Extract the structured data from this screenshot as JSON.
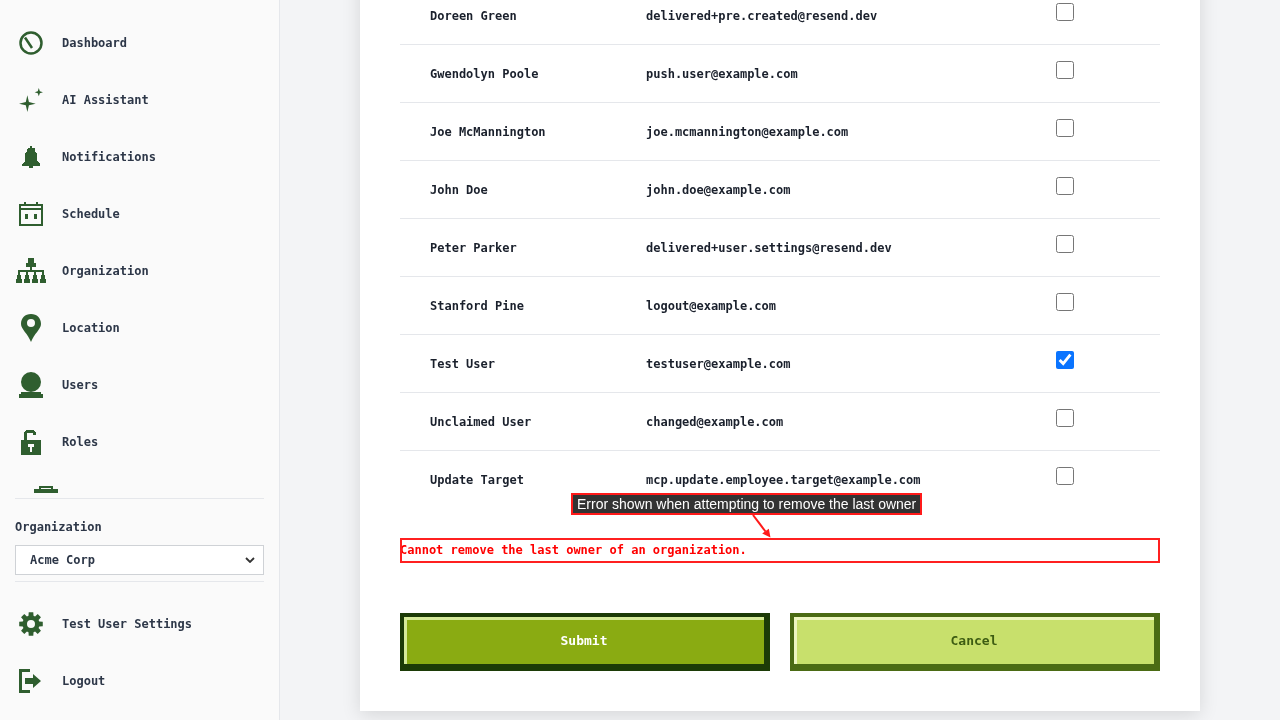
{
  "sidebar": {
    "nav_items": [
      {
        "label": "Dashboard"
      },
      {
        "label": "AI Assistant"
      },
      {
        "label": "Notifications"
      },
      {
        "label": "Schedule"
      },
      {
        "label": "Organization"
      },
      {
        "label": "Location"
      },
      {
        "label": "Users"
      },
      {
        "label": "Roles"
      }
    ],
    "organization_picker": {
      "label": "Organization",
      "value": "Acme Corp"
    },
    "footer_items": [
      {
        "label": "Test User Settings"
      },
      {
        "label": "Logout"
      }
    ]
  },
  "members_table": {
    "rows": [
      {
        "name": "Doreen Green",
        "email": "delivered+pre.created@resend.dev",
        "checked": false
      },
      {
        "name": "Gwendolyn Poole",
        "email": "push.user@example.com",
        "checked": false
      },
      {
        "name": "Joe McMannington",
        "email": "joe.mcmannington@example.com",
        "checked": false
      },
      {
        "name": "John Doe",
        "email": "john.doe@example.com",
        "checked": false
      },
      {
        "name": "Peter Parker",
        "email": "delivered+user.settings@resend.dev",
        "checked": false
      },
      {
        "name": "Stanford Pine",
        "email": "logout@example.com",
        "checked": false
      },
      {
        "name": "Test User",
        "email": "testuser@example.com",
        "checked": true
      },
      {
        "name": "Unclaimed User",
        "email": "changed@example.com",
        "checked": false
      },
      {
        "name": "Update Target",
        "email": "mcp.update.employee.target@example.com",
        "checked": false
      }
    ]
  },
  "annotation": {
    "text": "Error shown when attempting to remove the last owner"
  },
  "error_message": "Cannot remove the last owner of an organization.",
  "buttons": [
    {
      "label": "Submit",
      "kind": "primary"
    },
    {
      "label": "Cancel",
      "kind": "secondary"
    }
  ]
}
